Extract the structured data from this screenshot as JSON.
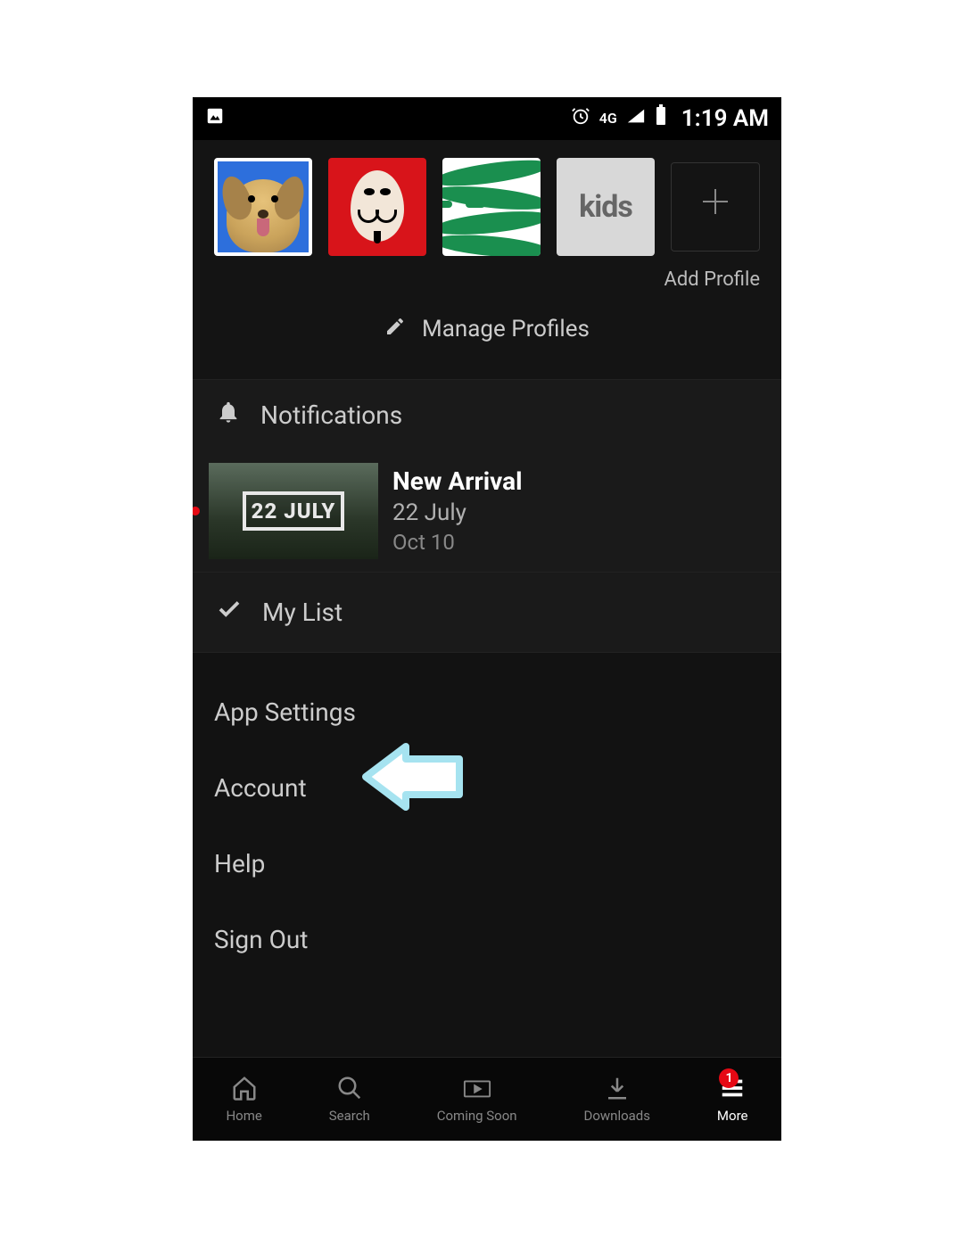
{
  "status_bar": {
    "network_type": "4G",
    "time": "1:19 AM"
  },
  "profiles": {
    "items": [
      {
        "name": "profile-1",
        "kind": "dog",
        "selected": true
      },
      {
        "name": "profile-2",
        "kind": "mask",
        "selected": false
      },
      {
        "name": "profile-3",
        "kind": "green",
        "selected": false
      },
      {
        "name": "profile-4",
        "kind": "kids",
        "label": "kids",
        "selected": false
      }
    ],
    "add_label": "Add Profile",
    "manage_label": "Manage Profiles"
  },
  "notifications": {
    "header_label": "Notifications",
    "items": [
      {
        "unread": true,
        "thumb_text": "22 JULY",
        "title": "New Arrival",
        "subtitle": "22 July",
        "date": "Oct 10"
      }
    ]
  },
  "mylist_label": "My List",
  "settings": {
    "items": [
      {
        "label": "App Settings"
      },
      {
        "label": "Account",
        "highlighted": true
      },
      {
        "label": "Help"
      },
      {
        "label": "Sign Out"
      }
    ]
  },
  "bottom_nav": {
    "items": [
      {
        "label": "Home",
        "icon": "home-icon",
        "active": false
      },
      {
        "label": "Search",
        "icon": "search-icon",
        "active": false
      },
      {
        "label": "Coming Soon",
        "icon": "coming-soon-icon",
        "active": false
      },
      {
        "label": "Downloads",
        "icon": "download-icon",
        "active": false
      },
      {
        "label": "More",
        "icon": "hamburger-icon",
        "active": true,
        "badge": "1"
      }
    ]
  },
  "colors": {
    "accent": "#e50914",
    "annotation_stroke": "#a6e3f0"
  }
}
